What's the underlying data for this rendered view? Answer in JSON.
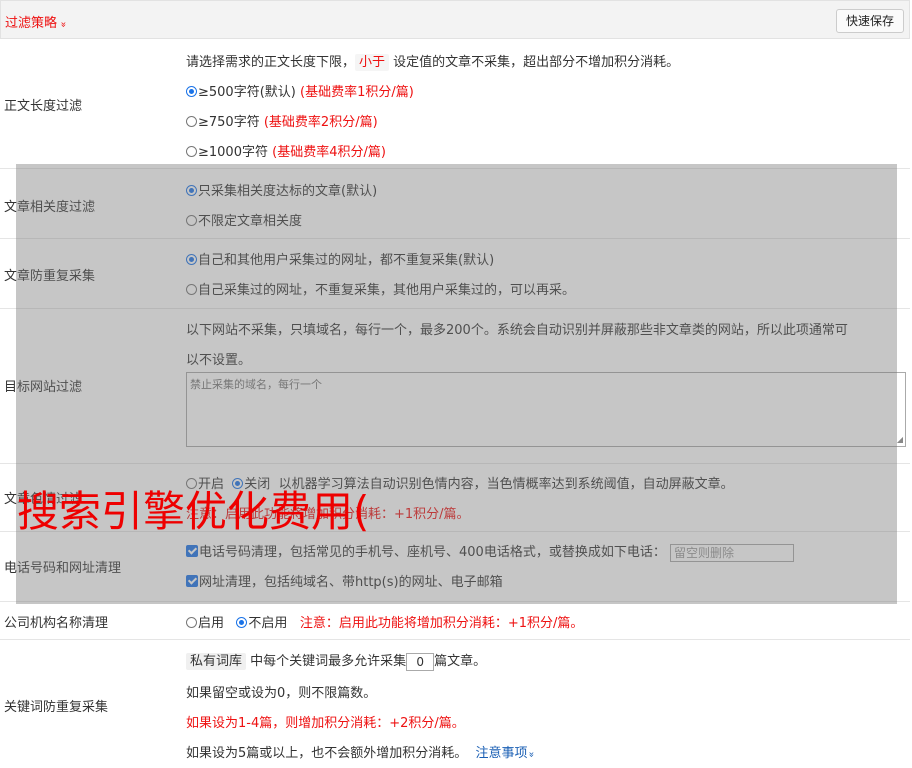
{
  "header": {
    "title": "过滤策略",
    "chevron": "»",
    "save_label": "快速保存"
  },
  "body_length": {
    "label": "正文长度过滤",
    "desc_prefix": "请选择需求的正文长度下限，",
    "desc_tag": "小于",
    "desc_suffix": "设定值的文章不采集，超出部分不增加积分消耗。",
    "options": [
      {
        "text": "≥500字符(默认)",
        "note": "(基础费率1积分/篇)",
        "checked": true
      },
      {
        "text": "≥750字符",
        "note": "(基础费率2积分/篇)",
        "checked": false
      },
      {
        "text": "≥1000字符",
        "note": "(基础费率4积分/篇)",
        "checked": false
      }
    ]
  },
  "relevance": {
    "label": "文章相关度过滤",
    "options": [
      {
        "text": "只采集相关度达标的文章(默认)",
        "checked": true
      },
      {
        "text": "不限定文章相关度",
        "checked": false
      }
    ]
  },
  "dedupe": {
    "label": "文章防重复采集",
    "options": [
      {
        "text": "自己和其他用户采集过的网址，都不重复采集(默认)",
        "checked": true
      },
      {
        "text": "自己采集过的网址，不重复采集，其他用户采集过的，可以再采。",
        "checked": false
      }
    ]
  },
  "site_filter": {
    "label": "目标网站过滤",
    "desc_line1": "以下网站不采集，只填域名，每行一个，最多200个。系统会自动识别并屏蔽那些非文章类的网站，所以此项通常可",
    "desc_line2": "以不设置。",
    "placeholder": "禁止采集的域名，每行一个",
    "resize_icon": "◢"
  },
  "porn_filter": {
    "label": "文章色情过滤",
    "opt_on": "开启",
    "opt_off": "关闭",
    "desc": "以机器学习算法自动识别色情内容，当色情概率达到系统阈值，自动屏蔽文章。",
    "note": "注意：启用此功能将增加积分消耗：+1积分/篇。"
  },
  "phone_url": {
    "label": "电话号码和网址清理",
    "phone_text": "电话号码清理，包括常见的手机号、座机号、400电话格式，或替换成如下电话：",
    "phone_placeholder": "留空则删除",
    "url_text": "网址清理，包括纯域名、带http(s)的网址、电子邮箱"
  },
  "company": {
    "label": "公司机构名称清理",
    "opt_on": "启用",
    "opt_off": "不启用",
    "note": "注意：启用此功能将增加积分消耗：+1积分/篇。"
  },
  "keyword_dedupe": {
    "label": "关键词防重复采集",
    "tag": "私有词库",
    "line1_prefix": "中每个关键词最多允许采集",
    "value": "0",
    "line1_suffix": "篇文章。",
    "line2": "如果留空或设为0，则不限篇数。",
    "line3": "如果设为1-4篇，则增加积分消耗：+2积分/篇。",
    "line4": "如果设为5篇或以上，也不会额外增加积分消耗。",
    "link": "注意事项",
    "link_chevron": "»"
  },
  "watermark": {
    "text": "搜索引擎优化费用("
  }
}
